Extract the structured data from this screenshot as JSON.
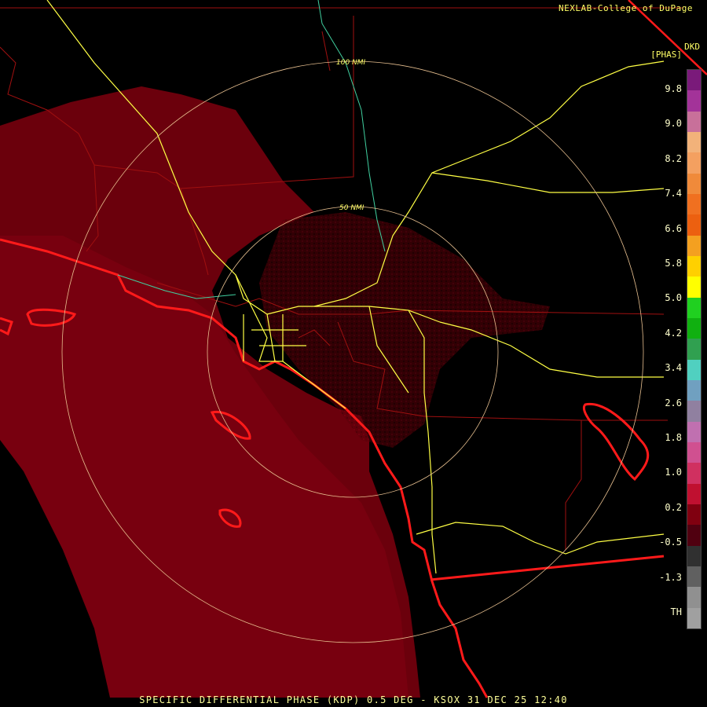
{
  "header": {
    "credit": "NEXLAB-College of DuPage",
    "product_code": "DKD",
    "product_unit": "[PHAS]"
  },
  "range_rings": [
    {
      "label": "100 NMI"
    },
    {
      "label": "50 NMI"
    }
  ],
  "legend": {
    "labels": [
      "9.8",
      "9.0",
      "8.2",
      "7.4",
      "6.6",
      "5.8",
      "5.0",
      "4.2",
      "3.4",
      "2.6",
      "1.8",
      "1.0",
      "0.2",
      "-0.5",
      "-1.3",
      "TH"
    ],
    "colors": [
      "#7a1a7a",
      "#a33399",
      "#c8709a",
      "#f2b27a",
      "#f4a060",
      "#f08a3a",
      "#f07020",
      "#ec6010",
      "#f4a020",
      "#ffd000",
      "#ffff00",
      "#20d020",
      "#10b010",
      "#30a050",
      "#50d0c0",
      "#70a0c0",
      "#9080a0",
      "#c070b0",
      "#d05090",
      "#d03060",
      "#c01030",
      "#800010",
      "#500010",
      "#303030",
      "#606060",
      "#909090",
      "#a0a0a0"
    ]
  },
  "caption": "SPECIFIC DIFFERENTIAL PHASE (KDP) 0.5 DEG - KSOX 31 DEC 25 12:40"
}
